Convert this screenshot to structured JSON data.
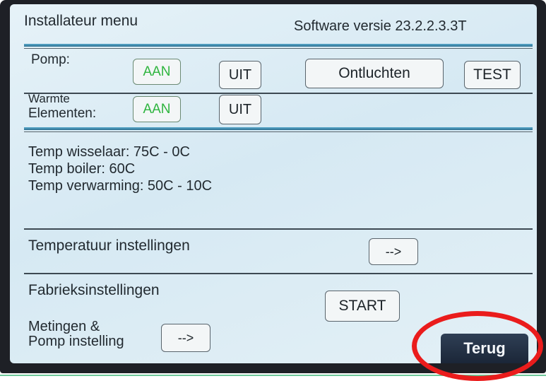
{
  "header": {
    "title": "Installateur menu",
    "software_version": "Software versie 23.2.2.3.3T"
  },
  "pomp": {
    "label": "Pomp:",
    "aan_label": "AAN",
    "uit_label": "UIT",
    "ontluchten_label": "Ontluchten",
    "test_label": "TEST"
  },
  "warmte": {
    "label_line1": "Warmte",
    "label_line2": "Elementen:",
    "aan_label": "AAN",
    "uit_label": "UIT"
  },
  "temps": {
    "wisselaar": "Temp wisselaar: 75C - 0C",
    "boiler": "Temp boiler: 60C",
    "verwarming": "Temp verwarming:  50C - 10C"
  },
  "temperatuur": {
    "label": "Temperatuur instellingen",
    "arrow_label": "-->"
  },
  "fabriek": {
    "label": "Fabrieksinstellingen",
    "start_label": "START"
  },
  "metingen": {
    "label_line1": "Metingen &",
    "label_line2": "Pomp instelling",
    "arrow_label": "-->"
  },
  "terug": {
    "label": "Terug"
  },
  "colors": {
    "active_green": "#2fb53f",
    "highlight_red": "#ea1c1c",
    "terug_button": "#22304a"
  }
}
